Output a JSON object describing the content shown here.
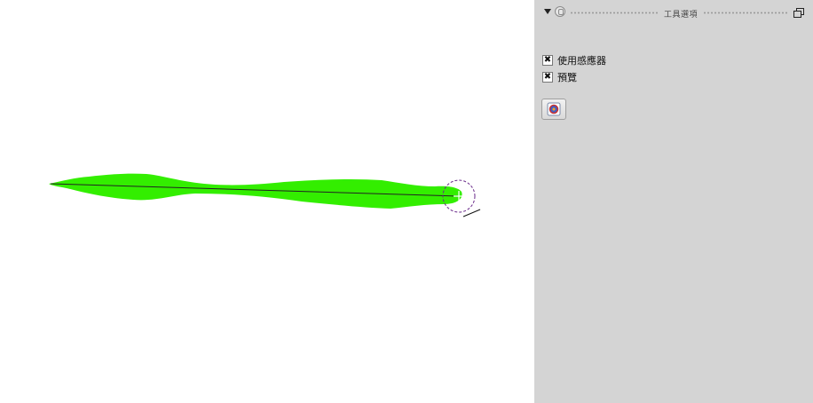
{
  "panel": {
    "title": "工具選項",
    "options": [
      {
        "label": "使用感應器",
        "checked": true,
        "mark": "✖"
      },
      {
        "label": "預覽",
        "checked": true,
        "mark": "✖"
      }
    ],
    "tool_button_icon": "brush-preset-icon"
  },
  "canvas": {
    "stroke_color": "#33ee00",
    "guide_line_color": "#222222",
    "cursor_color": "#6a2a8a"
  }
}
